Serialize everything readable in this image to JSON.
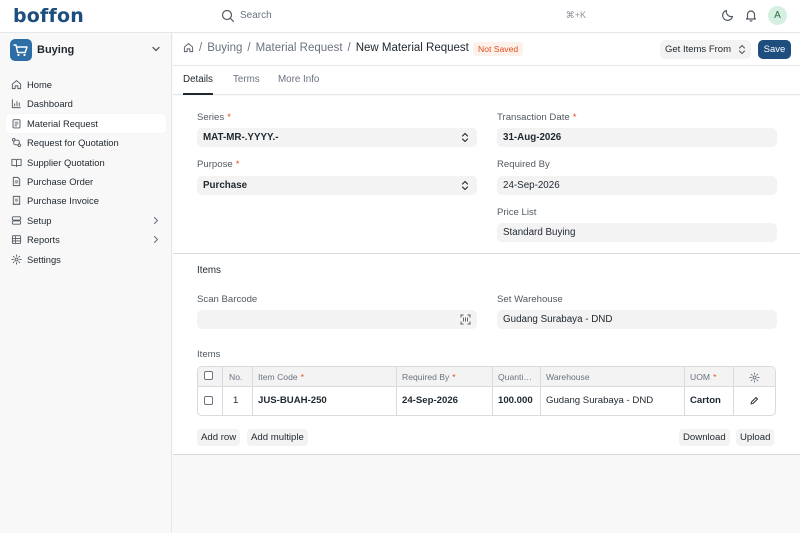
{
  "app": {
    "logo": "boffon"
  },
  "topbar": {
    "search_placeholder": "Search",
    "search_shortcut": "⌘+K",
    "avatar_initial": "A"
  },
  "sidebar": {
    "workspace": "Buying",
    "items": [
      {
        "label": "Home",
        "icon": "home-icon"
      },
      {
        "label": "Dashboard",
        "icon": "bar-chart-icon"
      },
      {
        "label": "Material Request",
        "icon": "clipboard-icon",
        "active": true
      },
      {
        "label": "Request for Quotation",
        "icon": "git-compare-icon"
      },
      {
        "label": "Supplier Quotation",
        "icon": "book-open-icon"
      },
      {
        "label": "Purchase Order",
        "icon": "file-text-icon"
      },
      {
        "label": "Purchase Invoice",
        "icon": "receipt-icon"
      },
      {
        "label": "Setup",
        "icon": "database-icon",
        "has_children": true
      },
      {
        "label": "Reports",
        "icon": "table-icon",
        "has_children": true
      },
      {
        "label": "Settings",
        "icon": "gear-icon"
      }
    ]
  },
  "header": {
    "breadcrumbs": [
      "Buying",
      "Material Request"
    ],
    "title": "New Material Request",
    "status": "Not Saved",
    "get_items_label": "Get Items From",
    "save_label": "Save"
  },
  "tabs": [
    "Details",
    "Terms",
    "More Info"
  ],
  "form": {
    "series": {
      "label": "Series",
      "value": "MAT-MR-.YYYY.-"
    },
    "purpose": {
      "label": "Purpose",
      "value": "Purchase"
    },
    "transaction_date": {
      "label": "Transaction Date",
      "value": "31-Aug-2026"
    },
    "required_by": {
      "label": "Required By",
      "value": "24-Sep-2026"
    },
    "price_list": {
      "label": "Price List",
      "value": "Standard Buying"
    },
    "items_section_title": "Items",
    "scan_barcode": {
      "label": "Scan Barcode",
      "value": ""
    },
    "set_warehouse": {
      "label": "Set Warehouse",
      "value": "Gudang Surabaya - DND"
    },
    "items_table_label": "Items"
  },
  "items_table": {
    "columns": [
      "No.",
      "Item Code",
      "Required By",
      "Quanti…",
      "Warehouse",
      "UOM"
    ],
    "rows": [
      {
        "no": "1",
        "item_code": "JUS-BUAH-250",
        "required_by": "24-Sep-2026",
        "quantity": "100.000",
        "warehouse": "Gudang Surabaya - DND",
        "uom": "Carton"
      }
    ],
    "add_row_label": "Add row",
    "add_multiple_label": "Add multiple",
    "download_label": "Download",
    "upload_label": "Upload"
  },
  "colors": {
    "primary": "#1d4e7e",
    "status_orange": "#e2501b",
    "required_star": "#e2501b"
  }
}
